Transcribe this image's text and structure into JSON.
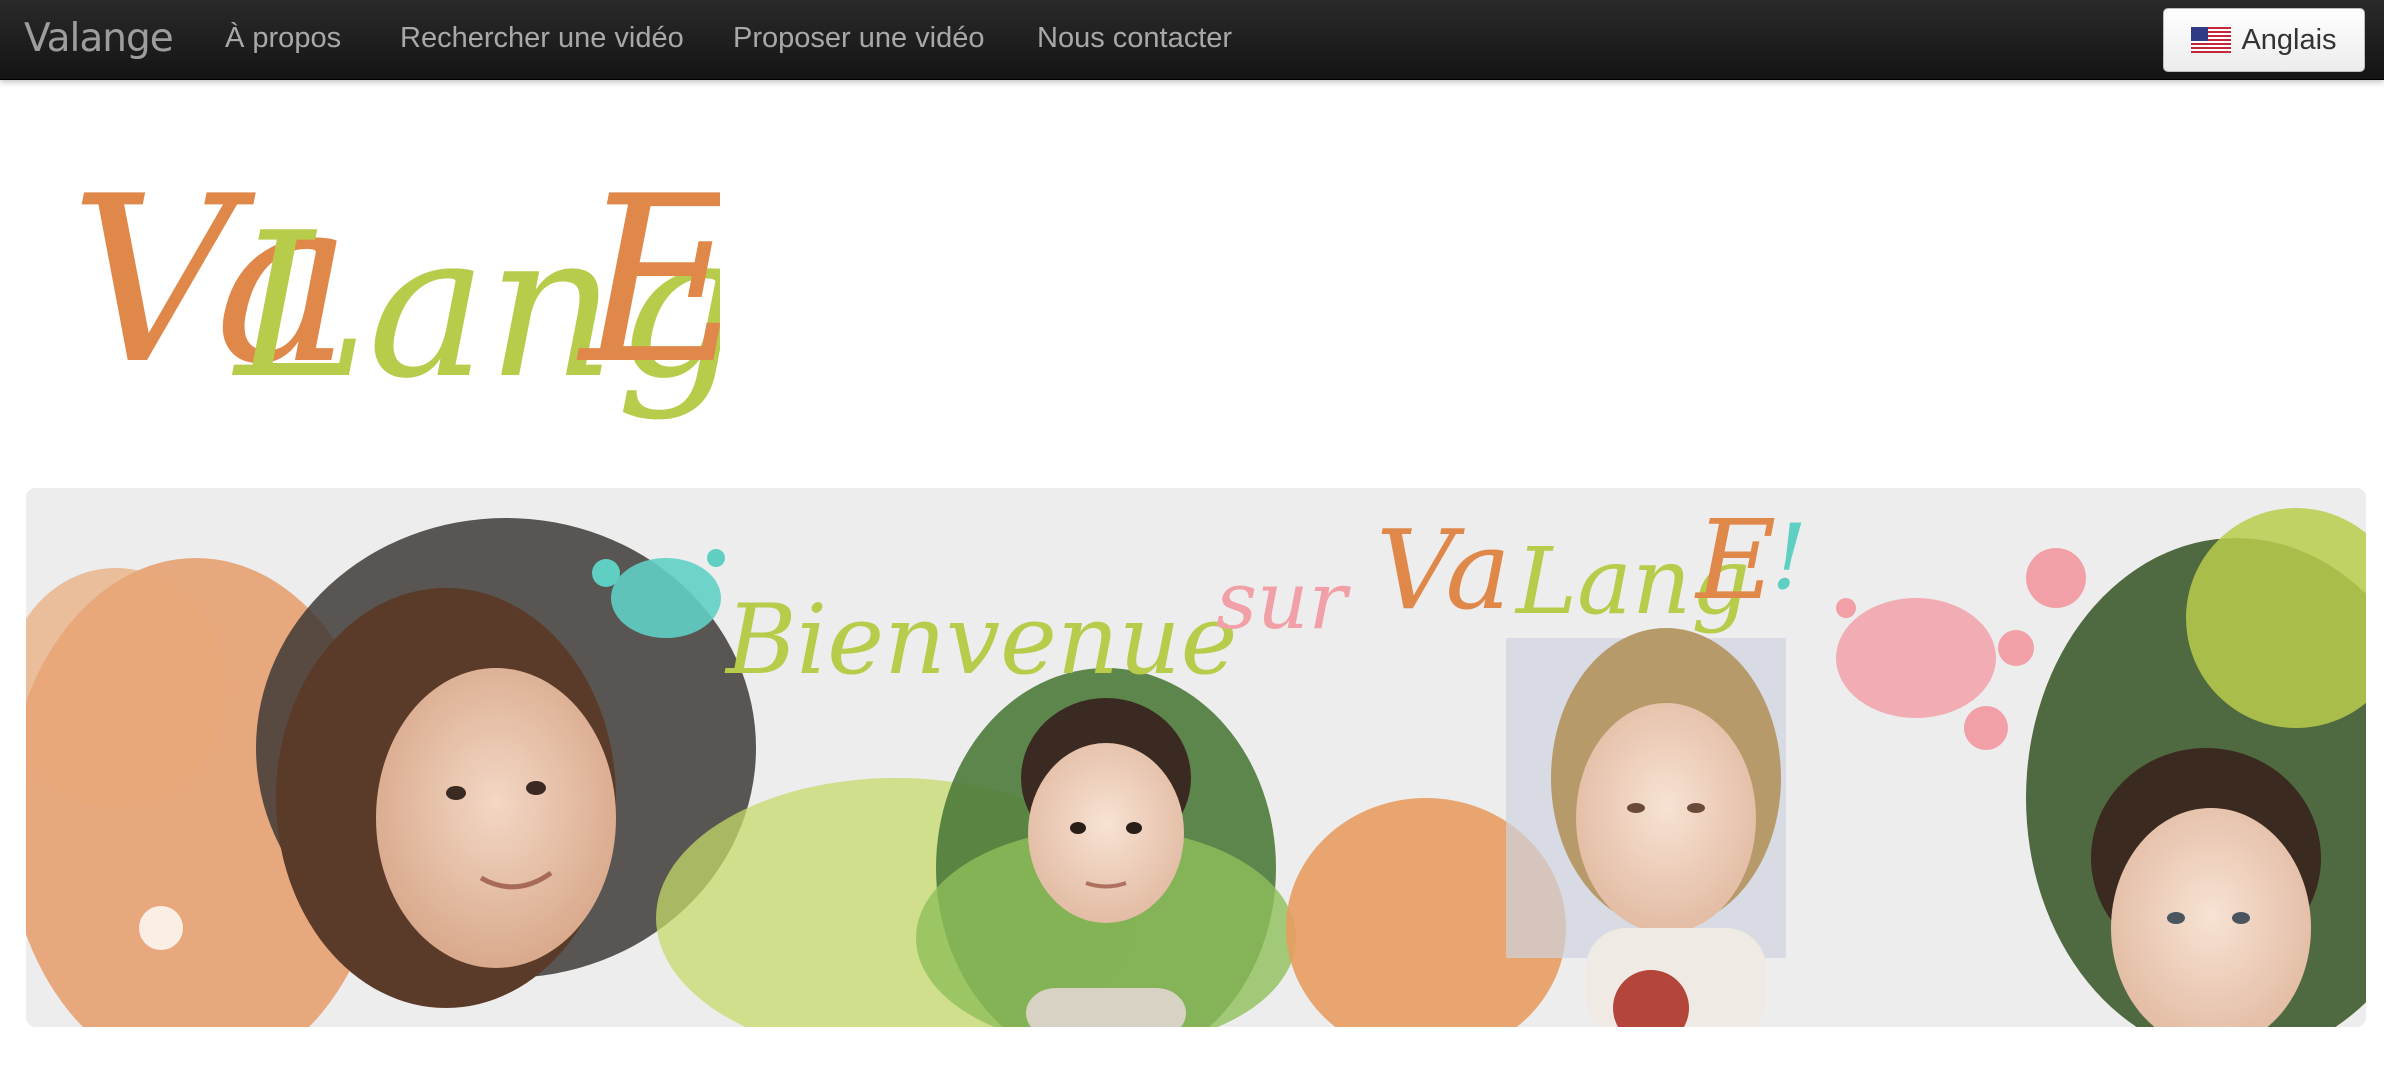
{
  "navbar": {
    "brand": "Valange",
    "links": [
      "À propos",
      "Rechercher une vidéo",
      "Proposer une vidéo",
      "Nous contacter"
    ],
    "language_button": {
      "label": "Anglais",
      "flag_icon": "us-flag-icon"
    }
  },
  "logo": {
    "parts": [
      "Va",
      "Lang",
      "E"
    ],
    "colors": {
      "orange": "#e0884a",
      "green": "#b8cc4c"
    }
  },
  "banner": {
    "heading_parts": [
      "Bienvenue",
      "sur",
      "Va",
      "Lang",
      "E",
      "!"
    ],
    "colors": {
      "orange": "#e0884a",
      "green": "#b8cc4c",
      "pink": "#f2a0a8",
      "teal": "#5fcfc4",
      "background": "#ededed"
    }
  }
}
